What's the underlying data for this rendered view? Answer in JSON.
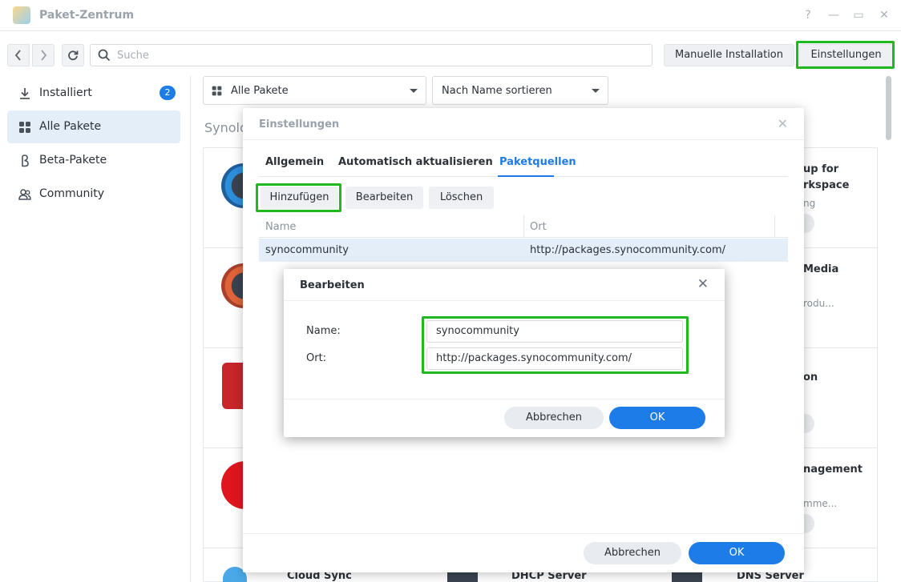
{
  "window": {
    "title": "Paket-Zentrum",
    "controls": [
      "?",
      "—",
      "▭",
      "✕"
    ]
  },
  "toolbar": {
    "back_icon": "chevron-left-icon",
    "forward_icon": "chevron-right-icon",
    "refresh_icon": "refresh-icon",
    "search_placeholder": "Suche",
    "manual_install_label": "Manuelle Installation",
    "settings_label": "Einstellungen"
  },
  "sidebar": {
    "items": [
      {
        "label": "Installiert",
        "icon": "download-icon",
        "badge": "2"
      },
      {
        "label": "Alle Pakete",
        "icon": "grid-icon",
        "active": true
      },
      {
        "label": "Beta-Pakete",
        "icon": "beta-icon"
      },
      {
        "label": "Community",
        "icon": "community-icon"
      }
    ]
  },
  "main": {
    "filter_label": "Alle Pakete",
    "sort_label": "Nach Name sortieren",
    "section_title": "Synolo",
    "right_cards": [
      {
        "title_line1": "up for",
        "title_line2": "rkspace",
        "sub": "ng"
      },
      {
        "title_line1": "Media",
        "sub": "rodu..."
      },
      {
        "title_line1": "on"
      },
      {
        "title_line1": "nagement",
        "sub": "mme..."
      }
    ],
    "bottom_cards": [
      "Cloud Sync",
      "DHCP Server",
      "DNS Server"
    ]
  },
  "settings_dialog": {
    "title": "Einstellungen",
    "tabs": [
      "Allgemein",
      "Automatisch aktualisieren",
      "Paketquellen"
    ],
    "active_tab": "Paketquellen",
    "buttons": {
      "add": "Hinzufügen",
      "edit": "Bearbeiten",
      "delete": "Löschen"
    },
    "columns": {
      "name": "Name",
      "location": "Ort"
    },
    "rows": [
      {
        "name": "synocommunity",
        "location": "http://packages.synocommunity.com/"
      }
    ],
    "cancel_label": "Abbrechen",
    "ok_label": "OK"
  },
  "edit_dialog": {
    "title": "Bearbeiten",
    "name_label": "Name:",
    "name_value": "synocommunity",
    "location_label": "Ort:",
    "location_value": "http://packages.synocommunity.com/",
    "cancel_label": "Abbrechen",
    "ok_label": "OK"
  },
  "colors": {
    "accent": "#1e7ce8",
    "highlight": "#1eb91e",
    "active_bg": "#e4eef9"
  }
}
